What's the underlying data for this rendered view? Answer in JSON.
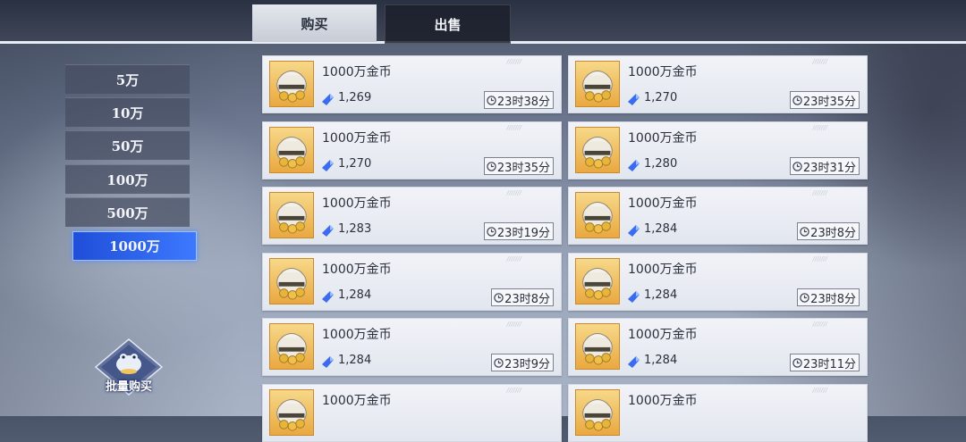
{
  "tabs": {
    "buy_label": "购买",
    "sell_label": "出售",
    "active": "buy"
  },
  "denominations": [
    {
      "label": "5万"
    },
    {
      "label": "10万"
    },
    {
      "label": "50万"
    },
    {
      "label": "100万"
    },
    {
      "label": "500万"
    },
    {
      "label": "1000万"
    }
  ],
  "selected_denomination": "1000万",
  "listings": [
    {
      "name": "1000万金币",
      "price": "1,269",
      "time": "23时38分"
    },
    {
      "name": "1000万金币",
      "price": "1,270",
      "time": "23时35分"
    },
    {
      "name": "1000万金币",
      "price": "1,270",
      "time": "23时35分"
    },
    {
      "name": "1000万金币",
      "price": "1,280",
      "time": "23时31分"
    },
    {
      "name": "1000万金币",
      "price": "1,283",
      "time": "23时19分"
    },
    {
      "name": "1000万金币",
      "price": "1,284",
      "time": "23时8分"
    },
    {
      "name": "1000万金币",
      "price": "1,284",
      "time": "23时8分"
    },
    {
      "name": "1000万金币",
      "price": "1,284",
      "time": "23时8分"
    },
    {
      "name": "1000万金币",
      "price": "1,284",
      "time": "23时9分"
    },
    {
      "name": "1000万金币",
      "price": "1,284",
      "time": "23时11分"
    },
    {
      "name": "1000万金币"
    },
    {
      "name": "1000万金币"
    }
  ],
  "bulk_buy": {
    "label": "批量购买",
    "icon": "frog-coin-icon"
  },
  "colors": {
    "accent": "#2f63f0",
    "card": "#eceff5",
    "gem": "#3a6bf0",
    "item_frame": "#e9a840"
  }
}
